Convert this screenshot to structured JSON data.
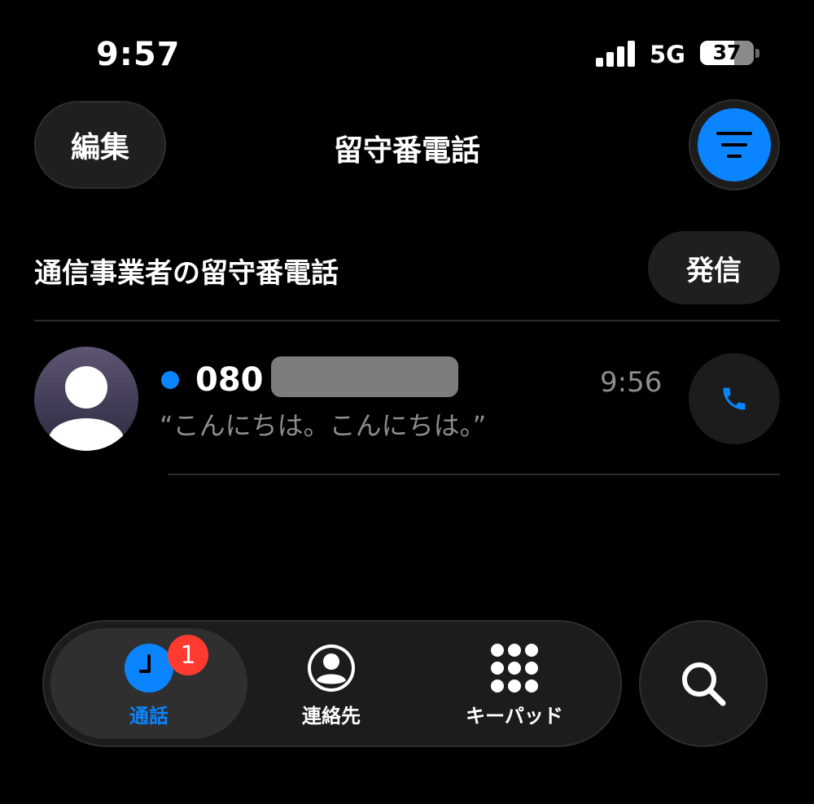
{
  "status_bar": {
    "time": "9:57",
    "network": "5G",
    "battery": "37",
    "battery_level": 0.37
  },
  "header": {
    "edit_label": "編集",
    "title": "留守番電話",
    "filter_icon": "filter-lines-icon"
  },
  "section": {
    "title": "通信事業者の留守番電話",
    "call_label": "発信"
  },
  "voicemails": [
    {
      "number": "080",
      "time": "9:56",
      "transcript": "“こんにちは。こんにちは。”",
      "unread": true
    }
  ],
  "tabs": [
    {
      "label": "通話",
      "icon": "clock-icon",
      "active": true,
      "badge": "1"
    },
    {
      "label": "連絡先",
      "icon": "person-circle-icon",
      "active": false
    },
    {
      "label": "キーパッド",
      "icon": "keypad-icon",
      "active": false
    }
  ],
  "colors": {
    "accent": "#0a84ff",
    "badge": "#ff3b30",
    "secondary_text": "#8d8d8d"
  }
}
